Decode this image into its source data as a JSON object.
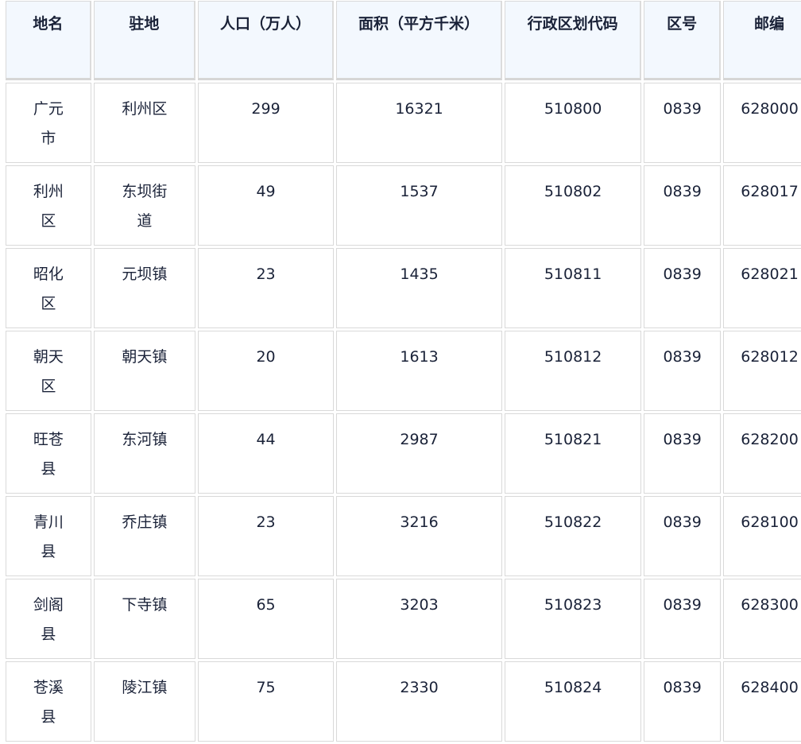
{
  "table": {
    "headers": [
      "地名",
      "驻地",
      "人口（万人）",
      "面积（平方千米）",
      "行政区划代码",
      "区号",
      "邮编"
    ],
    "rows": [
      {
        "name": "广元市",
        "seat": "利州区",
        "population": "299",
        "area": "16321",
        "code": "510800",
        "area_code": "0839",
        "postcode": "628000"
      },
      {
        "name": "利州区",
        "seat": "东坝街道",
        "population": "49",
        "area": "1537",
        "code": "510802",
        "area_code": "0839",
        "postcode": "628017"
      },
      {
        "name": "昭化区",
        "seat": "元坝镇",
        "population": "23",
        "area": "1435",
        "code": "510811",
        "area_code": "0839",
        "postcode": "628021"
      },
      {
        "name": "朝天区",
        "seat": "朝天镇",
        "population": "20",
        "area": "1613",
        "code": "510812",
        "area_code": "0839",
        "postcode": "628012"
      },
      {
        "name": "旺苍县",
        "seat": "东河镇",
        "population": "44",
        "area": "2987",
        "code": "510821",
        "area_code": "0839",
        "postcode": "628200"
      },
      {
        "name": "青川县",
        "seat": "乔庄镇",
        "population": "23",
        "area": "3216",
        "code": "510822",
        "area_code": "0839",
        "postcode": "628100"
      },
      {
        "name": "剑阁县",
        "seat": "下寺镇",
        "population": "65",
        "area": "3203",
        "code": "510823",
        "area_code": "0839",
        "postcode": "628300"
      },
      {
        "name": "苍溪县",
        "seat": "陵江镇",
        "population": "75",
        "area": "2330",
        "code": "510824",
        "area_code": "0839",
        "postcode": "628400"
      }
    ]
  },
  "colors": {
    "header_bg": "#f3f8fe",
    "border": "#d9d9d9",
    "text": "#1a2238"
  }
}
